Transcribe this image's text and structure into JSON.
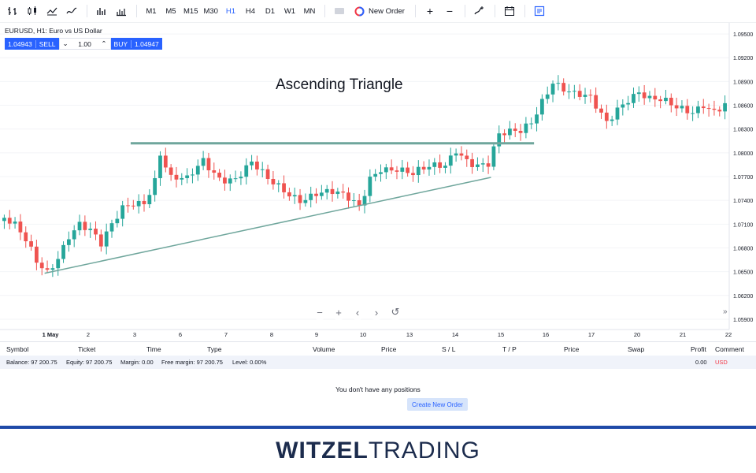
{
  "toolbar": {
    "timeframes": [
      "M1",
      "M5",
      "M15",
      "M30",
      "H1",
      "H4",
      "D1",
      "W1",
      "MN"
    ],
    "active_timeframe": "H1",
    "new_order_label": "New Order"
  },
  "symbol": {
    "title": "EURUSD, H1: Euro vs US Dollar",
    "sell_price": "1.04943",
    "sell_label": "SELL",
    "quantity": "1.00",
    "buy_label": "BUY",
    "buy_price": "1.04947"
  },
  "chart_title": "Ascending Triangle",
  "chart_data": {
    "type": "candlestick",
    "title": "Ascending Triangle",
    "x_tick_labels": [
      "1 May",
      "2",
      "3",
      "6",
      "7",
      "8",
      "9",
      "10",
      "13",
      "14",
      "15",
      "16",
      "17",
      "20",
      "21",
      "22"
    ],
    "y_tick_labels": [
      "1.09500",
      "1.09200",
      "1.08900",
      "1.08600",
      "1.08300",
      "1.08000",
      "1.07700",
      "1.07400",
      "1.07100",
      "1.06800",
      "1.06500",
      "1.06200",
      "1.05900"
    ],
    "ylim": [
      1.058,
      1.0962
    ],
    "price_path": [
      [
        0,
        1.0718
      ],
      [
        2,
        1.0705
      ],
      [
        4,
        1.0685
      ],
      [
        6,
        1.066
      ],
      [
        8,
        1.065
      ],
      [
        10,
        1.0672
      ],
      [
        12,
        1.07
      ],
      [
        14,
        1.0712
      ],
      [
        16,
        1.07
      ],
      [
        18,
        1.068
      ],
      [
        20,
        1.0705
      ],
      [
        22,
        1.073
      ],
      [
        24,
        1.074
      ],
      [
        26,
        1.0742
      ],
      [
        28,
        1.0768
      ],
      [
        29,
        1.08
      ],
      [
        31,
        1.0765
      ],
      [
        34,
        1.0762
      ],
      [
        37,
        1.079
      ],
      [
        40,
        1.0772
      ],
      [
        43,
        1.077
      ],
      [
        46,
        1.0785
      ],
      [
        49,
        1.0762
      ],
      [
        52,
        1.0752
      ],
      [
        55,
        1.0745
      ],
      [
        58,
        1.0752
      ],
      [
        61,
        1.0748
      ],
      [
        64,
        1.0738
      ],
      [
        66,
        1.073
      ],
      [
        68,
        1.077
      ],
      [
        70,
        1.0785
      ],
      [
        73,
        1.0782
      ],
      [
        76,
        1.077
      ],
      [
        79,
        1.0778
      ],
      [
        82,
        1.0785
      ],
      [
        84,
        1.0808
      ],
      [
        86,
        1.0795
      ],
      [
        88,
        1.0786
      ],
      [
        90,
        1.0784
      ],
      [
        92,
        1.0818
      ],
      [
        94,
        1.0822
      ],
      [
        96,
        1.0827
      ],
      [
        98,
        1.0842
      ],
      [
        100,
        1.087
      ],
      [
        102,
        1.0893
      ],
      [
        104,
        1.088
      ],
      [
        106,
        1.087
      ],
      [
        109,
        1.0865
      ],
      [
        112,
        1.084
      ],
      [
        114,
        1.086
      ],
      [
        116,
        1.0872
      ],
      [
        118,
        1.0878
      ],
      [
        120,
        1.0865
      ],
      [
        122,
        1.0862
      ],
      [
        125,
        1.0855
      ],
      [
        128,
        1.0855
      ],
      [
        130,
        1.0866
      ],
      [
        132,
        1.0855
      ],
      [
        134,
        1.086
      ]
    ],
    "resistance_line": {
      "x_start": 24,
      "x_end": 99,
      "y": 1.0812
    },
    "support_line": {
      "x_start": 8,
      "y_start": 1.0648,
      "x_end": 91,
      "y_end": 1.0769
    }
  },
  "positions": {
    "columns": [
      "Symbol",
      "Ticket",
      "Time",
      "Type",
      "Volume",
      "Price",
      "S / L",
      "T / P",
      "Price",
      "Swap",
      "Profit",
      "Comment"
    ],
    "balance": "Balance: 97 200.75",
    "equity": "Equity: 97 200.75",
    "margin": "Margin: 0.00",
    "free_margin": "Free margin: 97 200.75",
    "level": "Level: 0.00%",
    "profit_total": "0.00",
    "currency": "USD",
    "empty_message": "You don't have any positions",
    "create_order_label": "Create New Order"
  },
  "brand": {
    "part1": "WITZEL",
    "part2": "TRADING"
  },
  "colors": {
    "up": "#26a69a",
    "down": "#ef5350",
    "accent": "#2962ff",
    "line": "#6fa69c"
  }
}
